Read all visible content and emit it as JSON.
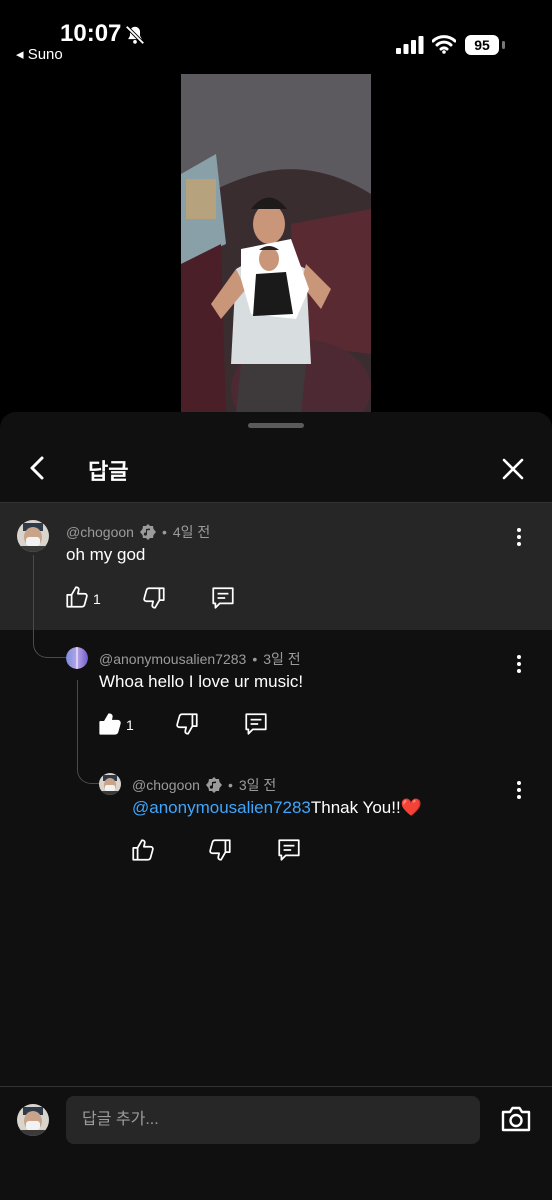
{
  "status_bar": {
    "time": "10:07",
    "back_app": "◂ Suno",
    "battery": "95"
  },
  "sheet": {
    "title": "답글"
  },
  "comments": [
    {
      "handle": "@chogoon",
      "verified": true,
      "dot": "•",
      "age": "4일 전",
      "text": "oh my god",
      "likes": "1",
      "liked": false
    },
    {
      "handle": "@anonymousalien7283",
      "verified": false,
      "dot": "•",
      "age": "3일 전",
      "text": "Whoa hello I love ur music!",
      "likes": "1",
      "liked": true
    },
    {
      "handle": "@chogoon",
      "verified": true,
      "dot": "•",
      "age": "3일 전",
      "mention": "@anonymousalien7283",
      "text": "Thnak You!!",
      "emoji": "❤️",
      "likes": "",
      "liked": false
    }
  ],
  "composer": {
    "placeholder": "답글 추가..."
  },
  "colors": {
    "mention": "#3ea6ff",
    "highlight_bg": "#262626",
    "sheet_bg": "#101010"
  },
  "icons": [
    "bell-slash-icon",
    "signal-icon",
    "wifi-icon",
    "battery-icon",
    "back-arrow-icon",
    "close-icon",
    "verified-music-icon",
    "thumb-up-icon",
    "thumb-down-icon",
    "reply-icon",
    "more-vert-icon",
    "camera-icon"
  ]
}
